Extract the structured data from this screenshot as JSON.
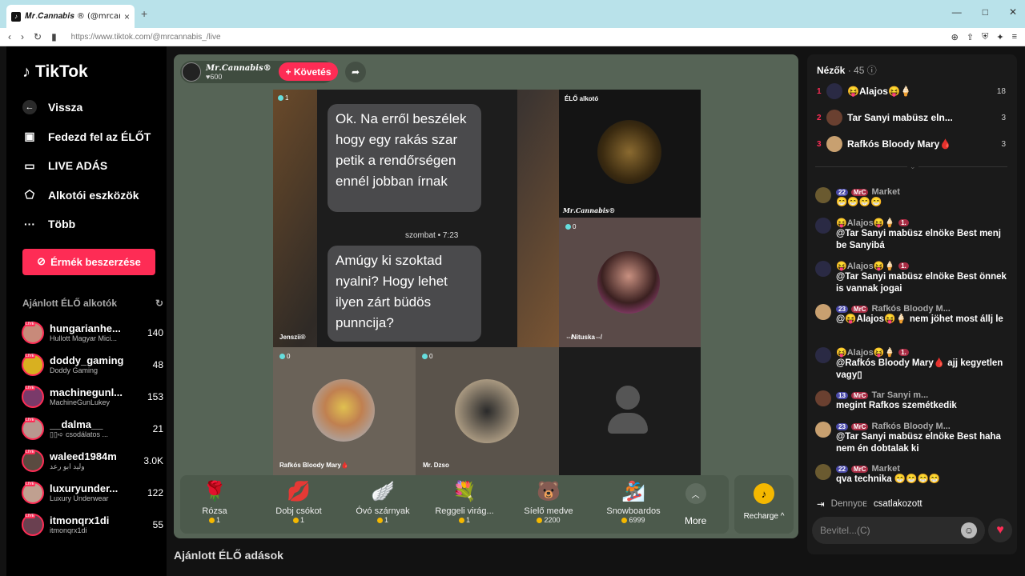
{
  "browser": {
    "tab_title": "𝑴𝒓.𝑪𝒂𝒏𝒏𝒂𝒃𝒊𝒔 ® (@mrcann",
    "tab_close": "×",
    "new_tab": "+",
    "url": "https://www.tiktok.com/@mrcannabis_/live",
    "win_min": "—",
    "win_max": "□",
    "win_close": "✕"
  },
  "sidebar": {
    "logo_text": "TikTok",
    "nav": [
      {
        "label": "Vissza",
        "icon": "back-arrow-icon"
      },
      {
        "label": "Fedezd fel az ÉLŐT",
        "icon": "calendar-live-icon"
      },
      {
        "label": "LIVE ADÁS",
        "icon": "video-camera-icon"
      },
      {
        "label": "Alkotói eszközök",
        "icon": "creator-tools-icon"
      },
      {
        "label": "Több",
        "icon": "more-dots-icon"
      }
    ],
    "coins_button": "Érmék beszerzése",
    "recommended_title": "Ajánlott ÉLŐ alkotók",
    "live_badge": "LIVE",
    "recommended": [
      {
        "name": "hungarianhe...",
        "sub": "Hullott Magyar Mici...",
        "count": "140"
      },
      {
        "name": "doddy_gaming",
        "sub": "Doddy Gaming",
        "count": "48"
      },
      {
        "name": "machinegunl...",
        "sub": "MachineGunLukey",
        "count": "153"
      },
      {
        "name": "__dalma__",
        "sub": "▯▯➪ csodálatos ...",
        "count": "21"
      },
      {
        "name": "waleed1984m",
        "sub": "وليد ابو رعد",
        "count": "3.0K"
      },
      {
        "name": "luxuryunder...",
        "sub": "Luxury Underwear",
        "count": "122"
      },
      {
        "name": "itmonqrx1di",
        "sub": "itmonqrx1di",
        "count": "55"
      }
    ]
  },
  "stream": {
    "host_name": "𝑴𝒓.𝑪𝒂𝒏𝒏𝒂𝒃𝒊𝒔®",
    "host_likes": "♥600",
    "follow_label": "+ Követés",
    "main_bubble_1": "Ok. Na erről beszélek hogy egy rakás szar petik a rendőrségen ennél jobban írnak",
    "main_timestamp": "szombat • 7:23",
    "main_bubble_2": "Amúgy ki szoktad nyalni? Hogy lehet ilyen zárt büdös punncija?",
    "main_count": "1",
    "main_label": "Jenszii®",
    "host_tile_label": "ÉLŐ alkotó",
    "host_tile_name": "𝑴𝒓.𝑪𝒂𝒏𝒏𝒂𝒃𝒊𝒔®",
    "tile2_count": "0",
    "tile2_label": "⇎Nituska⇎",
    "tile3_count": "0",
    "tile3_label": "Rafkós Bloody Mary🩸",
    "tile4_count": "0",
    "tile4_label": "Mr. Dzso"
  },
  "gifts": [
    {
      "name": "Rózsa",
      "price": "1",
      "icon": "🌹"
    },
    {
      "name": "Dobj csókot",
      "price": "1",
      "icon": "💋"
    },
    {
      "name": "Óvó szárnyak",
      "price": "1",
      "icon": "🪽"
    },
    {
      "name": "Reggeli virág...",
      "price": "1",
      "icon": "💐"
    },
    {
      "name": "Síelő medve",
      "price": "2200",
      "icon": "🐻"
    },
    {
      "name": "Snowboardos",
      "price": "6999",
      "icon": "🏂"
    }
  ],
  "gift_more": "More",
  "recharge": "Recharge ^",
  "below_title": "Ajánlott ÉLŐ adások",
  "chat": {
    "viewers_label": "Nézők",
    "viewers_count": "· 45",
    "top_viewers": [
      {
        "rank": "1",
        "name": "😝Alajos😝🍦",
        "score": "18"
      },
      {
        "rank": "2",
        "name": "Tar Sanyi mabüsz eln...",
        "score": "3"
      },
      {
        "rank": "3",
        "name": "Rafkós Bloody Mary🩸",
        "score": "3"
      }
    ],
    "messages": [
      {
        "b1": "22",
        "b2": "MrC",
        "user": "Market",
        "text": "😁😁😁😁"
      },
      {
        "b1": "",
        "b2": "1.",
        "user": "😝Alajos😝🍦",
        "text": "@Tar Sanyi mabüsz elnöke Best menj be Sanyibá"
      },
      {
        "b1": "",
        "b2": "1.",
        "user": "😝Alajos😝🍦",
        "text": "@Tar Sanyi mabüsz elnöke Best önnek is vannak jogai"
      },
      {
        "b1": "23",
        "b2": "MrC",
        "user": "Rafkós Bloody M...",
        "text": "@😝Alajos😝🍦 nem jöhet most állj le"
      },
      {
        "b1": "",
        "b2": "1.",
        "user": "😝Alajos😝🍦",
        "text": "@Rafkós Bloody Mary🩸 ajj kegyetlen vagy▯"
      },
      {
        "b1": "13",
        "b2": "MrC",
        "user": "Tar Sanyi m...",
        "text": "megint Rafkos szemétkedik"
      },
      {
        "b1": "23",
        "b2": "MrC",
        "user": "Rafkós Bloody M...",
        "text": "@Tar Sanyi mabüsz elnöke Best haha nem én dobtalak ki"
      },
      {
        "b1": "22",
        "b2": "MrC",
        "user": "Market",
        "text": "qva technika 😁😁😁😁"
      }
    ],
    "joined_user": "Dennyᴅᴇ",
    "joined_text": "csatlakozott",
    "input_placeholder": "Bevitel...(C)"
  }
}
